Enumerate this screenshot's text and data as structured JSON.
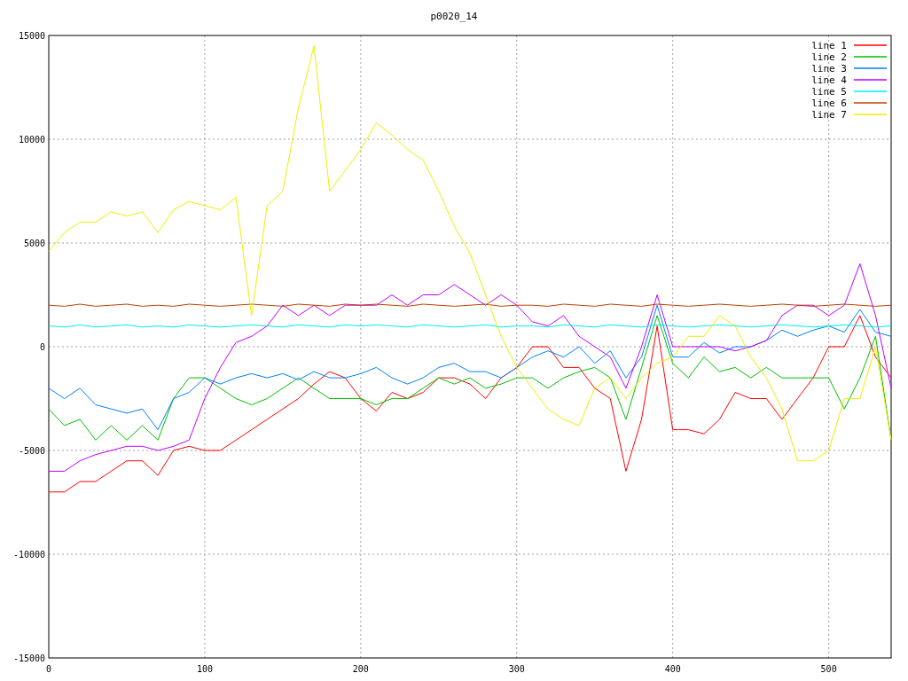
{
  "chart_data": {
    "type": "line",
    "title": "p0020_14",
    "x": [
      0,
      10,
      20,
      30,
      40,
      50,
      60,
      70,
      80,
      90,
      100,
      110,
      120,
      130,
      140,
      150,
      160,
      170,
      180,
      190,
      200,
      210,
      220,
      230,
      240,
      250,
      260,
      270,
      280,
      290,
      300,
      310,
      320,
      330,
      340,
      350,
      360,
      370,
      380,
      390,
      400,
      410,
      420,
      430,
      440,
      450,
      460,
      470,
      480,
      490,
      500,
      510,
      520,
      530,
      540
    ],
    "grid": true,
    "legend": true,
    "xlim": [
      0,
      540
    ],
    "ylim": [
      -15000,
      15000
    ],
    "xticks": [
      0,
      100,
      200,
      300,
      400,
      500
    ],
    "yticks": [
      -15000,
      -10000,
      -5000,
      0,
      5000,
      10000,
      15000
    ],
    "series": [
      {
        "name": "line 1",
        "color": "#ff0000",
        "values": [
          -7000,
          -7000,
          -6500,
          -6500,
          -6000,
          -5500,
          -5500,
          -6200,
          -5000,
          -4800,
          -5000,
          -5000,
          -4500,
          -4000,
          -3500,
          -3000,
          -2500,
          -1800,
          -1200,
          -1500,
          -2500,
          -3100,
          -2200,
          -2500,
          -2200,
          -1500,
          -1500,
          -1800,
          -2500,
          -1500,
          -1000,
          0,
          0,
          -1000,
          -1000,
          -2000,
          -2500,
          -6000,
          -3500,
          1000,
          -4000,
          -4000,
          -4200,
          -3500,
          -2200,
          -2500,
          -2500,
          -3500,
          -2500,
          -1500,
          0,
          0,
          1500,
          -500,
          -1500
        ]
      },
      {
        "name": "line 2",
        "color": "#00c000",
        "values": [
          -3000,
          -3800,
          -3500,
          -4500,
          -3800,
          -4500,
          -3800,
          -4500,
          -2500,
          -1500,
          -1500,
          -2000,
          -2500,
          -2800,
          -2500,
          -2000,
          -1500,
          -2000,
          -2500,
          -2500,
          -2500,
          -2800,
          -2500,
          -2500,
          -2000,
          -1500,
          -1800,
          -1500,
          -2000,
          -1800,
          -1500,
          -1500,
          -2000,
          -1500,
          -1200,
          -1000,
          -1500,
          -3500,
          -1000,
          1500,
          -800,
          -1500,
          -500,
          -1200,
          -1000,
          -1500,
          -1000,
          -1500,
          -1500,
          -1500,
          -1500,
          -3000,
          -1500,
          500,
          -4500
        ]
      },
      {
        "name": "line 3",
        "color": "#0080ff",
        "values": [
          -2000,
          -2500,
          -2000,
          -2800,
          -3000,
          -3200,
          -3000,
          -4000,
          -2500,
          -2200,
          -1500,
          -1800,
          -1500,
          -1300,
          -1500,
          -1300,
          -1600,
          -1200,
          -1500,
          -1500,
          -1300,
          -1000,
          -1500,
          -1800,
          -1500,
          -1000,
          -800,
          -1200,
          -1200,
          -1500,
          -1000,
          -500,
          -200,
          -500,
          0,
          -800,
          -200,
          -1500,
          -500,
          2000,
          -500,
          -500,
          200,
          -300,
          0,
          0,
          300,
          800,
          500,
          800,
          1000,
          700,
          1800,
          700,
          500
        ]
      },
      {
        "name": "line 4",
        "color": "#c000ff",
        "values": [
          -6000,
          -6000,
          -5500,
          -5200,
          -5000,
          -4800,
          -4800,
          -5000,
          -4800,
          -4500,
          -2500,
          -1000,
          200,
          500,
          1000,
          2000,
          1500,
          2000,
          1500,
          2000,
          2000,
          2000,
          2500,
          2000,
          2500,
          2500,
          3000,
          2500,
          2000,
          2500,
          2000,
          1200,
          1000,
          1500,
          500,
          0,
          -500,
          -2000,
          0,
          2500,
          0,
          0,
          0,
          0,
          -200,
          0,
          300,
          1500,
          2000,
          2000,
          1500,
          2000,
          4000,
          1500,
          -2000
        ]
      },
      {
        "name": "line 5",
        "color": "#00eeee",
        "values": [
          1000,
          950,
          1050,
          950,
          1000,
          1050,
          950,
          1000,
          950,
          1050,
          1000,
          950,
          1000,
          1050,
          1000,
          950,
          1050,
          1000,
          950,
          1050,
          1000,
          1050,
          1000,
          950,
          1050,
          1000,
          950,
          1000,
          1050,
          950,
          1000,
          1000,
          950,
          1050,
          1000,
          950,
          1050,
          1000,
          950,
          1050,
          1000,
          950,
          1000,
          1050,
          1000,
          950,
          1000,
          1050,
          1000,
          950,
          1000,
          1050,
          1000,
          950,
          1000
        ]
      },
      {
        "name": "line 6",
        "color": "#c04000",
        "values": [
          2000,
          1950,
          2050,
          1950,
          2000,
          2050,
          1950,
          2000,
          1950,
          2050,
          2000,
          1950,
          2000,
          2050,
          2000,
          1950,
          2050,
          2000,
          1950,
          2050,
          2000,
          2050,
          2000,
          1950,
          2050,
          2000,
          1950,
          2000,
          2050,
          1950,
          2000,
          2000,
          1950,
          2050,
          2000,
          1950,
          2050,
          2000,
          1950,
          2050,
          2000,
          1950,
          2000,
          2050,
          2000,
          1950,
          2000,
          2050,
          2000,
          1950,
          2000,
          2050,
          2000,
          1950,
          2000
        ]
      },
      {
        "name": "line 7",
        "color": "#eeee00",
        "values": [
          4600,
          5500,
          6000,
          6000,
          6500,
          6300,
          6500,
          5500,
          6600,
          7000,
          6800,
          6600,
          7200,
          1500,
          6800,
          7500,
          11500,
          14500,
          7500,
          8500,
          9500,
          10800,
          10200,
          9500,
          9000,
          7500,
          5800,
          4500,
          2500,
          500,
          -1000,
          -2000,
          -3000,
          -3500,
          -3800,
          -2000,
          -1500,
          -2500,
          -1500,
          -800,
          -500,
          500,
          500,
          1500,
          1000,
          -500,
          -1500,
          -3000,
          -5500,
          -5500,
          -5000,
          -2500,
          -2500,
          0,
          -4500
        ]
      }
    ]
  }
}
